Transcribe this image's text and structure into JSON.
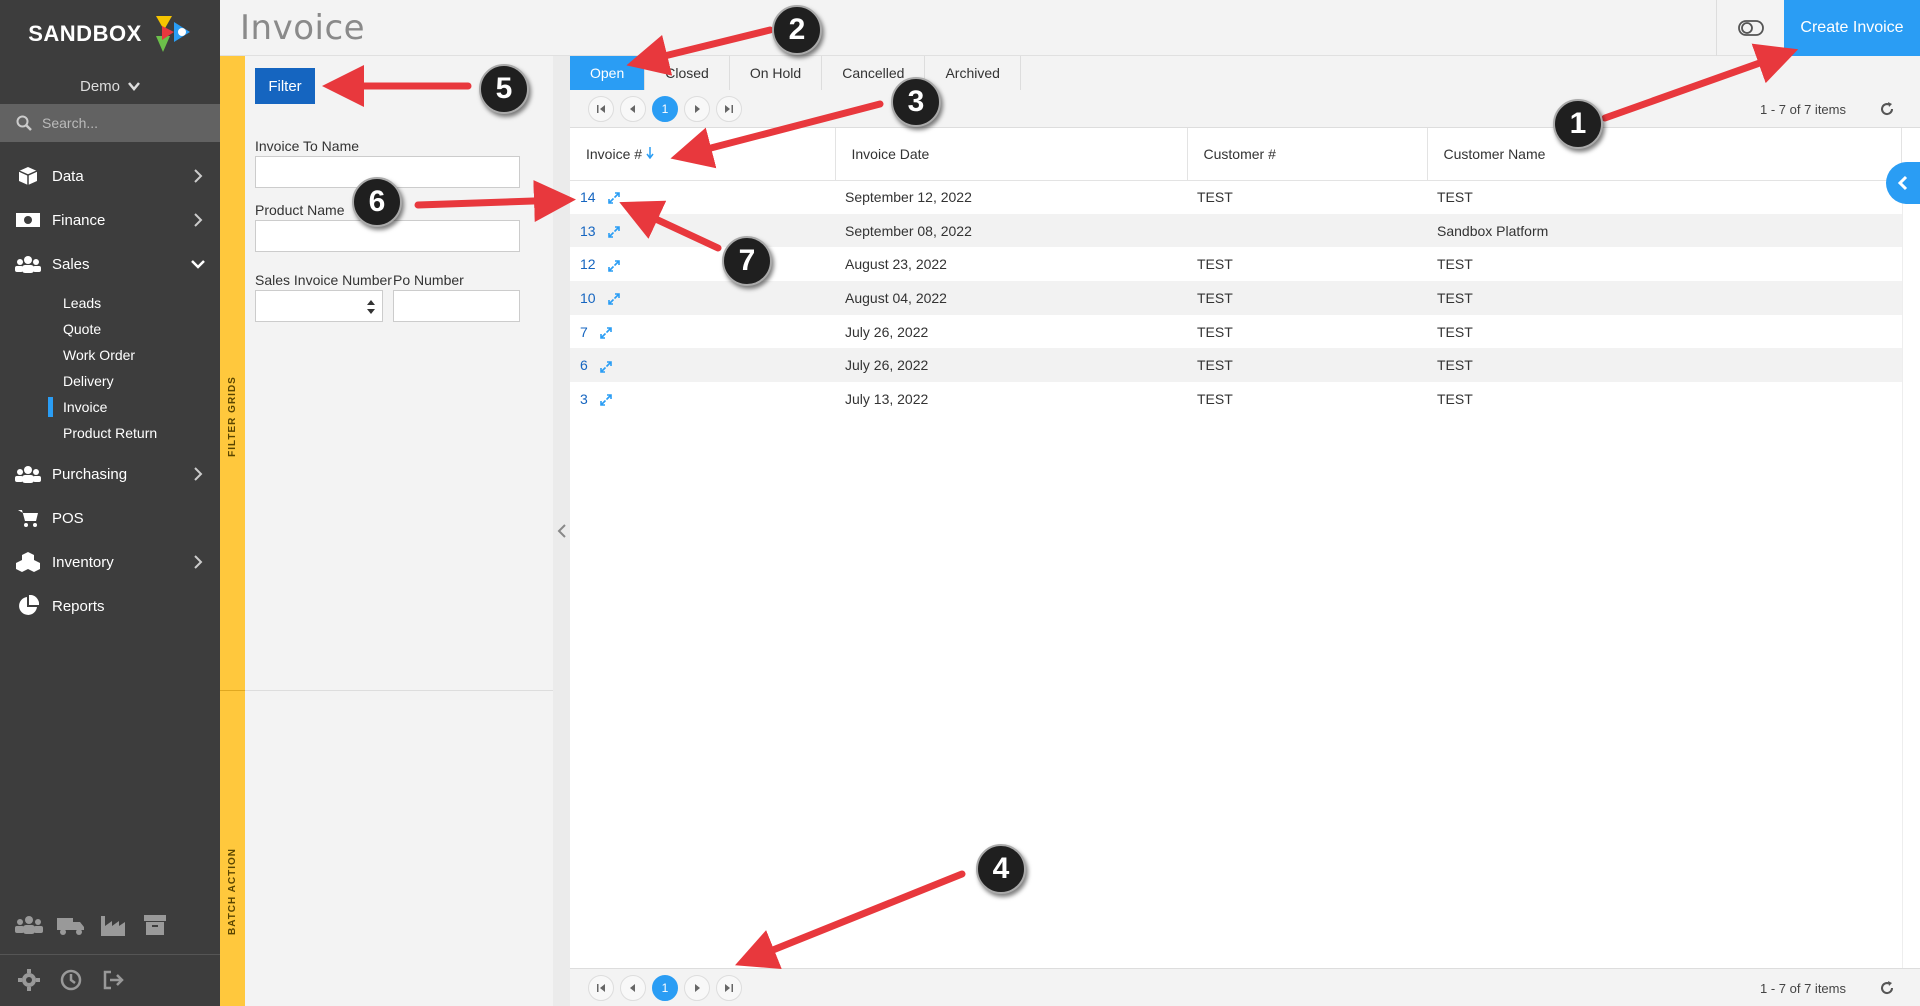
{
  "app": {
    "logo_text": "SANDBOX",
    "workspace": "Demo",
    "search_placeholder": "Search..."
  },
  "sidebar": {
    "items": [
      {
        "label": "Data",
        "icon": "cube-icon",
        "expandable": true
      },
      {
        "label": "Finance",
        "icon": "money-icon",
        "expandable": true
      },
      {
        "label": "Sales",
        "icon": "people-icon",
        "expanded": true
      },
      {
        "label": "Purchasing",
        "icon": "people-icon",
        "expandable": true
      },
      {
        "label": "POS",
        "icon": "cart-icon"
      },
      {
        "label": "Inventory",
        "icon": "boxes-icon",
        "expandable": true
      },
      {
        "label": "Reports",
        "icon": "pie-chart-icon"
      }
    ],
    "sales_subitems": [
      "Leads",
      "Quote",
      "Work Order",
      "Delivery",
      "Invoice",
      "Product Return"
    ],
    "active_subitem": "Invoice"
  },
  "header": {
    "title": "Invoice",
    "create_button": "Create Invoice"
  },
  "filter_strip": {
    "filter_grids": "FILTER GRIDS",
    "batch_action": "BATCH ACTION"
  },
  "filter": {
    "button": "Filter",
    "invoice_to_name_label": "Invoice To Name",
    "product_name_label": "Product Name",
    "sales_invoice_number_label": "Sales Invoice Number",
    "po_number_label": "Po Number"
  },
  "tabs": [
    "Open",
    "Closed",
    "On Hold",
    "Cancelled",
    "Archived"
  ],
  "active_tab": "Open",
  "pager": {
    "current_page": "1",
    "info": "1 - 7 of 7 items"
  },
  "grid": {
    "columns": [
      "Invoice #",
      "Invoice Date",
      "Customer #",
      "Customer Name"
    ],
    "rows": [
      {
        "invoice": "14",
        "date": "September 12, 2022",
        "customer_no": "TEST",
        "customer_name": "TEST"
      },
      {
        "invoice": "13",
        "date": "September 08, 2022",
        "customer_no": "",
        "customer_name": "Sandbox Platform"
      },
      {
        "invoice": "12",
        "date": "August 23, 2022",
        "customer_no": "TEST",
        "customer_name": "TEST"
      },
      {
        "invoice": "10",
        "date": "August 04, 2022",
        "customer_no": "TEST",
        "customer_name": "TEST"
      },
      {
        "invoice": "7",
        "date": "July 26, 2022",
        "customer_no": "TEST",
        "customer_name": "TEST"
      },
      {
        "invoice": "6",
        "date": "July 26, 2022",
        "customer_no": "TEST",
        "customer_name": "TEST"
      },
      {
        "invoice": "3",
        "date": "July 13, 2022",
        "customer_no": "TEST",
        "customer_name": "TEST"
      }
    ]
  },
  "annotations": [
    "1",
    "2",
    "3",
    "4",
    "5",
    "6",
    "7"
  ],
  "colors": {
    "accent": "#2a9df4",
    "sidebar": "#3d3d3d",
    "strip": "#ffc83d",
    "arrow": "#e8383d",
    "filter_button": "#1565c0"
  }
}
